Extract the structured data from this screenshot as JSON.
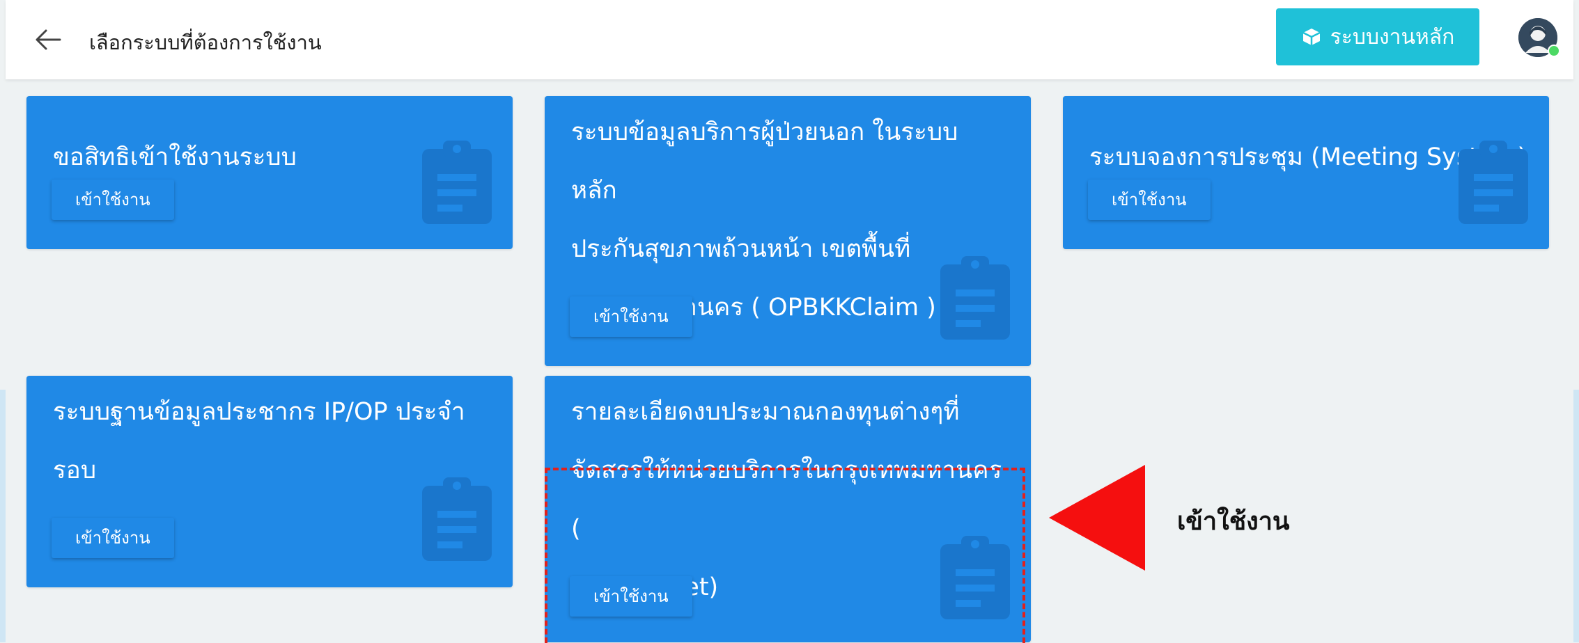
{
  "header": {
    "title": "เลือกระบบที่ต้องการใช้งาน",
    "main_button_label": "ระบบงานหลัก"
  },
  "cards": [
    {
      "title": "ขอสิทธิเข้าใช้งานระบบ",
      "button": "เข้าใช้งาน"
    },
    {
      "title": "ระบบข้อมูลบริการผู้ป่วยนอก ในระบบหลัก\nประกันสุขภาพถ้วนหน้า เขตพื้นที่\nกรุงเทพมหานคร ( OPBKKClaim )",
      "button": "เข้าใช้งาน"
    },
    {
      "title": "ระบบจองการประชุม (Meeting System)",
      "button": "เข้าใช้งาน"
    },
    {
      "title": "ระบบฐานข้อมูลประชากร IP/OP ประจำ\nรอบ",
      "button": "เข้าใช้งาน"
    },
    {
      "title": "รายละเอียดงบประมาณกองทุนต่างๆที่\nจัดสรรให้หน่วยบริการในกรุงเทพมหานคร (\nLinkBudget)",
      "button": "เข้าใช้งาน"
    }
  ],
  "annotation": {
    "label": "เข้าใช้งาน",
    "color": "#e2211c"
  },
  "colors": {
    "card": "#2089e6",
    "main_button": "#1fc1d8",
    "background": "#eef2f3"
  },
  "icons": [
    "back-arrow-icon",
    "box-icon",
    "user-avatar-icon",
    "clipboard-icon"
  ]
}
